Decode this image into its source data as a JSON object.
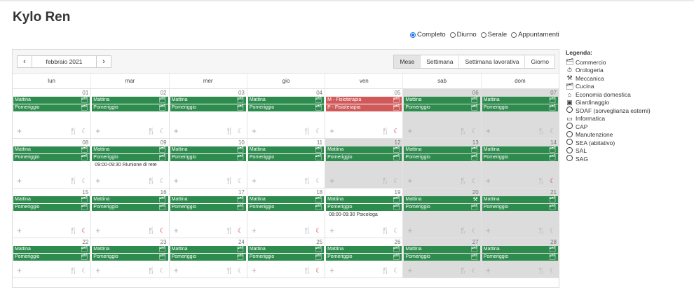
{
  "page": {
    "title": "Kylo Ren"
  },
  "view_options": [
    {
      "label": "Completo",
      "selected": true
    },
    {
      "label": "Diurno",
      "selected": false
    },
    {
      "label": "Serale",
      "selected": false
    },
    {
      "label": "Appuntamenti",
      "selected": false
    }
  ],
  "toolbar": {
    "prev": "‹",
    "next": "›",
    "month": "febbraio 2021",
    "tabs": [
      {
        "label": "Mese",
        "active": true
      },
      {
        "label": "Settimana",
        "active": false
      },
      {
        "label": "Settimana lavorativa",
        "active": false
      },
      {
        "label": "Giorno",
        "active": false
      }
    ]
  },
  "weekdays": [
    "lun",
    "mar",
    "mer",
    "gio",
    "ven",
    "sab",
    "dom"
  ],
  "icons": {
    "plus": "+",
    "fork": "🍴",
    "moon": "☾",
    "briefcase": "🗂",
    "tools": "⚒"
  },
  "weeks": [
    {
      "days": [
        {
          "num": "01",
          "ev1": "Mattina",
          "ev2": "Pomeriggio",
          "fork_red": false,
          "moon_red": false
        },
        {
          "num": "02",
          "ev1": "Mattina",
          "ev2": "Pomeriggio",
          "fork_red": false,
          "moon_red": false
        },
        {
          "num": "03",
          "ev1": "Mattina",
          "ev2": "Pomeriggio",
          "fork_red": false,
          "moon_red": false
        },
        {
          "num": "04",
          "ev1": "Mattina",
          "ev2": "Pomeriggio",
          "fork_red": false,
          "moon_red": false
        },
        {
          "num": "05",
          "ev1": "M - Fisioterapia",
          "ev2": "P - Fisioterapia",
          "red": true,
          "fork_red": true,
          "moon_red": true
        },
        {
          "num": "06",
          "ev1": "Mattina",
          "ev2": "Pomeriggio",
          "gray": true,
          "fork_red": false,
          "moon_red": false
        },
        {
          "num": "07",
          "ev1": "Mattina",
          "ev2": "Pomeriggio",
          "gray": true,
          "fork_red": false,
          "moon_red": false
        }
      ]
    },
    {
      "days": [
        {
          "num": "08",
          "ev1": "Mattina",
          "ev2": "Pomeriggio",
          "fork_red": false,
          "moon_red": false
        },
        {
          "num": "09",
          "ev1": "Mattina",
          "ev2": "Pomeriggio",
          "pill": "Appuntamenti",
          "note": "09:00-09:30 Riunione di rete",
          "fork_red": false,
          "moon_red": false
        },
        {
          "num": "10",
          "ev1": "Mattina",
          "ev2": "Pomeriggio",
          "fork_red": false,
          "moon_red": false
        },
        {
          "num": "11",
          "ev1": "Mattina",
          "ev2": "Pomeriggio",
          "fork_red": false,
          "moon_red": false
        },
        {
          "num": "12",
          "ev1": "Mattina",
          "ev2": "Pomeriggio",
          "gray": true,
          "fork_red": false,
          "moon_red": false
        },
        {
          "num": "13",
          "ev1": "Mattina",
          "ev2": "Pomeriggio",
          "gray": true,
          "fork_red": false,
          "moon_red": false
        },
        {
          "num": "14",
          "ev1": "Mattina",
          "ev2": "Pomeriggio",
          "gray": true,
          "fork_red": true,
          "moon_red": true
        }
      ]
    },
    {
      "days": [
        {
          "num": "15",
          "ev1": "Mattina",
          "ev2": "Pomeriggio",
          "fork_red": true,
          "moon_red": true
        },
        {
          "num": "16",
          "ev1": "Mattina",
          "ev2": "Pomeriggio",
          "fork_red": false,
          "moon_red": true
        },
        {
          "num": "17",
          "ev1": "Mattina",
          "ev2": "Pomeriggio",
          "fork_red": false,
          "moon_red": true
        },
        {
          "num": "18",
          "ev1": "Mattina",
          "ev2": "Pomeriggio",
          "fork_red": true,
          "moon_red": true
        },
        {
          "num": "19",
          "ev1": "Mattina",
          "ev2": "Pomeriggio",
          "pill": "Appuntamenti",
          "note": "08:00-09:30 Psicologa",
          "fork_red": false,
          "moon_red": false
        },
        {
          "num": "20",
          "ev1": "Mattina",
          "ev2": "Pomeriggio",
          "ev1_icon": "tools",
          "gray": true,
          "fork_red": true,
          "moon_red": false
        },
        {
          "num": "21",
          "ev1": "Mattina",
          "ev2": "Pomeriggio",
          "gray": true,
          "fork_red": false,
          "moon_red": false
        }
      ]
    },
    {
      "days": [
        {
          "num": "22",
          "ev1": "Mattina",
          "ev2": "Pomeriggio",
          "fork_red": false,
          "moon_red": false
        },
        {
          "num": "23",
          "ev1": "Mattina",
          "ev2": "Pomeriggio",
          "fork_red": false,
          "moon_red": false
        },
        {
          "num": "24",
          "ev1": "Mattina",
          "ev2": "Pomeriggio",
          "fork_red": true,
          "moon_red": false
        },
        {
          "num": "25",
          "ev1": "Mattina",
          "ev2": "Pomeriggio",
          "fork_red": true,
          "moon_red": true
        },
        {
          "num": "26",
          "ev1": "Mattina",
          "ev2": "Pomeriggio",
          "fork_red": true,
          "moon_red": false
        },
        {
          "num": "27",
          "ev1": "Mattina",
          "ev2": "Pomeriggio",
          "gray": true,
          "fork_red": false,
          "moon_red": false
        },
        {
          "num": "28",
          "ev1": "Mattina",
          "ev2": "Pomeriggio",
          "gray": true,
          "fork_red": false,
          "moon_red": false
        }
      ]
    }
  ],
  "legend": {
    "title": "Legenda:",
    "items": [
      {
        "label": "Commercio",
        "icon": "briefcase"
      },
      {
        "label": "Orologeria",
        "icon": "stopwatch"
      },
      {
        "label": "Meccanica",
        "icon": "tools"
      },
      {
        "label": "Cucina",
        "icon": "briefcase"
      },
      {
        "label": "Economia domestica",
        "icon": "household"
      },
      {
        "label": "Giardinaggio",
        "icon": "garden"
      },
      {
        "label": "SOAF (sorveglianza esterni)",
        "icon": "circle"
      },
      {
        "label": "Informatica",
        "icon": "laptop"
      },
      {
        "label": "CAP",
        "icon": "circle"
      },
      {
        "label": "Manutenzione",
        "icon": "circle"
      },
      {
        "label": "SEA (abitativo)",
        "icon": "circle"
      },
      {
        "label": "SAL",
        "icon": "circle"
      },
      {
        "label": "SAG",
        "icon": "circle"
      }
    ]
  }
}
